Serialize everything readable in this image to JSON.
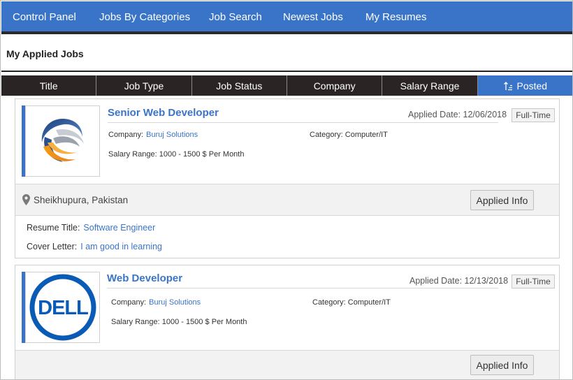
{
  "nav": {
    "items": [
      {
        "label": "Control Panel"
      },
      {
        "label": "Jobs By Categories"
      },
      {
        "label": "Job Search"
      },
      {
        "label": "Newest Jobs"
      },
      {
        "label": "My Resumes"
      }
    ]
  },
  "page": {
    "title": "My Applied Jobs"
  },
  "sortbar": {
    "columns": [
      {
        "label": "Title"
      },
      {
        "label": "Job Type"
      },
      {
        "label": "Job Status"
      },
      {
        "label": "Company"
      },
      {
        "label": "Salary Range"
      },
      {
        "label": "Posted",
        "active": true,
        "icon": "sort-ascending-icon"
      }
    ]
  },
  "colors": {
    "accent": "#3a74c9",
    "dark": "#2b2424"
  },
  "jobs": [
    {
      "title": "Senior Web Developer",
      "applied_date": "Applied Date: 12/06/2018",
      "type": "Full-Time",
      "company_label": "Company:",
      "company": "Buruj Solutions",
      "category_label": "Category:",
      "category": "Computer/IT",
      "salary_label": "Salary Range:",
      "salary": "1000 - 1500 $ Per Month",
      "location": "Sheikhupura, Pakistan",
      "applied_info": "Applied Info",
      "resume_label": "Resume Title:",
      "resume": "Software Engineer",
      "cover_label": "Cover Letter:",
      "cover": "I am good in learning",
      "logo": "globe-swirl-logo"
    },
    {
      "title": "Web Developer",
      "applied_date": "Applied Date: 12/13/2018",
      "type": "Full-Time",
      "company_label": "Company:",
      "company": "Buruj Solutions",
      "category_label": "Category:",
      "category": "Computer/IT",
      "salary_label": "Salary Range:",
      "salary": "1000 - 1500 $ Per Month",
      "applied_info": "Applied Info",
      "logo": "dell-logo",
      "logo_text": "DELL"
    }
  ]
}
